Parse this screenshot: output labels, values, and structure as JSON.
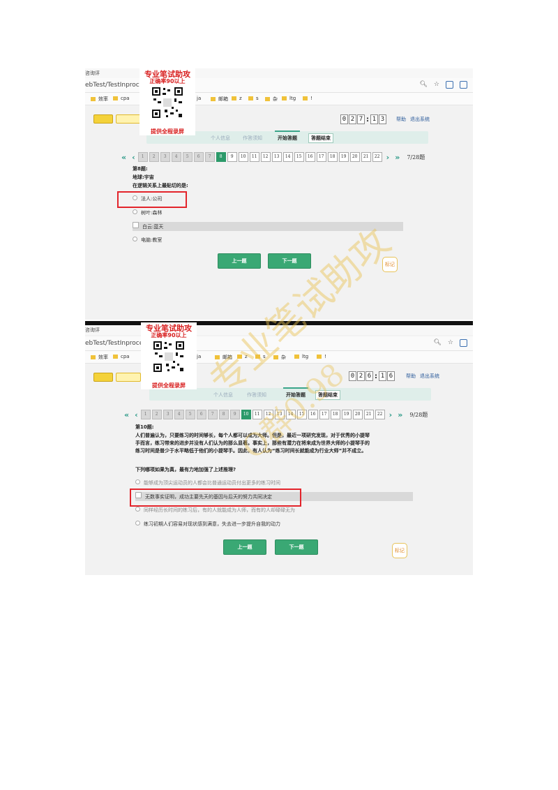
{
  "shot1": {
    "tab_title": "咨询评",
    "url": "ebTest/TestInprocess.a",
    "bookmarks": [
      "效率",
      "cpa",
      "ja",
      "邮箱",
      "z",
      "s",
      "杂",
      "ltg",
      "!"
    ],
    "timer": [
      "0",
      "2",
      "7",
      "1",
      "3"
    ],
    "links": {
      "help": "帮助",
      "exit": "退出系统"
    },
    "steps": [
      "个人信息",
      "作答须知",
      "开始答题",
      "答题结束"
    ],
    "pages": [
      "1",
      "2",
      "3",
      "4",
      "5",
      "6",
      "7",
      "8",
      "9",
      "10",
      "11",
      "12",
      "13",
      "14",
      "15",
      "16",
      "17",
      "18",
      "19",
      "20",
      "21",
      "22"
    ],
    "current_page": 8,
    "page_count": "7/28题",
    "question": {
      "number": "第8题:",
      "text": "地球:宇宙",
      "prompt": "在逻辑关系上最贴切的是:",
      "options": [
        "法人:公司",
        "树叶:森林",
        "白云:蓝天",
        "电脑:教室"
      ],
      "selected": 2
    },
    "buttons": {
      "prev": "上一题",
      "next": "下一题",
      "mark": "标记"
    }
  },
  "shot2": {
    "tab_title": "咨询评",
    "url": "ebTest/TestInprocess.a",
    "bookmarks": [
      "效率",
      "cpa",
      "ja",
      "邮箱",
      "z",
      "s",
      "杂",
      "ltg",
      "!"
    ],
    "timer": [
      "0",
      "2",
      "6",
      "1",
      "6"
    ],
    "links": {
      "help": "帮助",
      "exit": "退出系统"
    },
    "steps": [
      "个人信息",
      "作答须知",
      "开始答题",
      "答题结束"
    ],
    "pages": [
      "1",
      "2",
      "3",
      "4",
      "5",
      "6",
      "7",
      "8",
      "9",
      "10",
      "11",
      "12",
      "13",
      "14",
      "15",
      "16",
      "17",
      "18",
      "19",
      "20",
      "21",
      "22"
    ],
    "current_page": 10,
    "page_count": "9/28题",
    "question": {
      "number": "第10题:",
      "paragraph": [
        "人们普遍认为，只要练习的时间够长，每个人都可以成为大师。但是，最近一项研究发现，对于优秀的小提琴",
        "手而言，练习带来的进步并没有人们认为的那么显著。事实上，那些有潜力在将来成为世界大师的小提琴手的",
        "练习时间是普少于水平略低于他们的小提琴手。因此，有人认为“练习时间长就能成为行业大师”并不成立。"
      ],
      "prompt": "下列哪项如果为真，最有力地加强了上述推理?",
      "options": [
        "能够成为顶尖运动员的人都会比普通运动员付出更多的练习时间",
        "无数事实证明，成功主要先天的基因与后天的努力共同决定",
        "同样经历长时间的练习后，有的人就能成为人师，而有的人却碌碌无为",
        "练习初期人们容易对现状感到满意，失去进一步提升自我的动力"
      ],
      "selected": 1
    },
    "buttons": {
      "prev": "上一题",
      "next": "下一题",
      "mark": "标记"
    }
  },
  "ad": {
    "title": "专业笔试助攻",
    "subtitle": "正确率90以上",
    "footer": "提供全程录屏",
    "color": "#d81e1e"
  },
  "watermark": {
    "line1": "专业笔试助攻",
    "line2": "Q群0.98"
  },
  "colors": {
    "accent": "#2c9a6a",
    "highlight": "#e3242b",
    "step_bg": "#dfeeea"
  }
}
